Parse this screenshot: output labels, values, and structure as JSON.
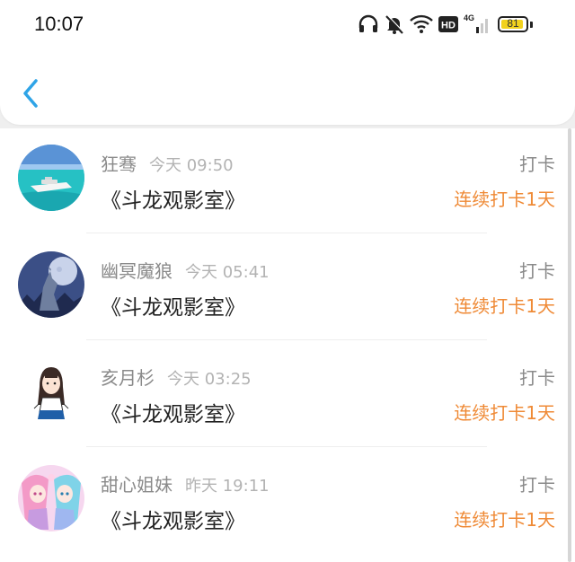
{
  "status_bar": {
    "time": "10:07",
    "battery": "81",
    "network_label": "4G",
    "hd_label": "HD",
    "icons": [
      "headphones-icon",
      "bell-muted-icon",
      "wifi-icon",
      "hd-icon",
      "signal-4g-icon",
      "battery-icon"
    ],
    "battery_color": "#f2d21d"
  },
  "header": {
    "back_icon": "chevron-left-icon",
    "accent_color": "#2fa4e7"
  },
  "items": [
    {
      "name": "狂骞",
      "time": "今天 09:50",
      "title": "《斗龙观影室》",
      "action": "打卡",
      "streak": "连续打卡1天",
      "avatar": "yacht-on-sea"
    },
    {
      "name": "幽冥魔狼",
      "time": "今天 05:41",
      "title": "《斗龙观影室》",
      "action": "打卡",
      "streak": "连续打卡1天",
      "avatar": "wolf-howling-at-moon"
    },
    {
      "name": "亥月杉",
      "time": "今天 03:25",
      "title": "《斗龙观影室》",
      "action": "打卡",
      "streak": "连续打卡1天",
      "avatar": "cartoon-girl"
    },
    {
      "name": "甜心姐妹",
      "time": "昨天 19:11",
      "title": "《斗龙观影室》",
      "action": "打卡",
      "streak": "连续打卡1天",
      "avatar": "anime-twin-girls"
    }
  ],
  "colors": {
    "streak": "#ef8a36",
    "name": "#8a8a8a",
    "time": "#b3b3b3"
  }
}
